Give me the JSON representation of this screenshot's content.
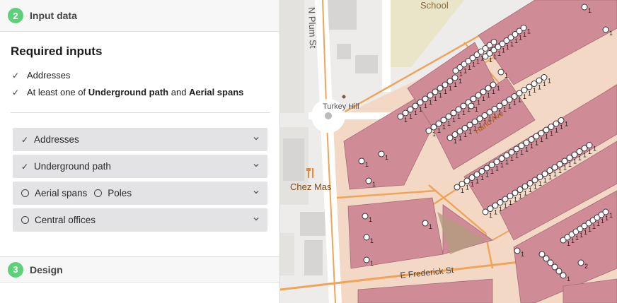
{
  "steps": [
    {
      "number": "2",
      "label": "Input data"
    },
    {
      "number": "3",
      "label": "Design"
    }
  ],
  "required": {
    "title": "Required inputs",
    "line1": {
      "text": "Addresses"
    },
    "line2": {
      "prefix": "At least one of ",
      "bold1": "Underground path",
      "mid": " and ",
      "bold2": "Aerial spans"
    }
  },
  "accordions": [
    {
      "label": "Addresses",
      "state": "checked"
    },
    {
      "label": "Underground path",
      "state": "checked"
    },
    {
      "label": "Aerial spans",
      "label2": "Poles",
      "state": "radio"
    },
    {
      "label": "Central offices",
      "state": "radio"
    }
  ],
  "map": {
    "labels": {
      "school": "School",
      "street_plum": "N Plum St",
      "turkey_hill": "Turkey Hill",
      "hand_ave": "Hand Ave",
      "chez_mas": "Chez Mas",
      "frederick": "E Frederick St"
    },
    "marker_digit": "1",
    "marker_digit_alt": "2",
    "colors": {
      "parcel": "#cf8b96",
      "parcel_dark": "#a66d77",
      "road": "#f0a45a",
      "block": "#dcd9d6",
      "green": "#e9e5c8"
    }
  },
  "icons": {
    "check": "✓",
    "chevron": "chevron-down-icon"
  }
}
